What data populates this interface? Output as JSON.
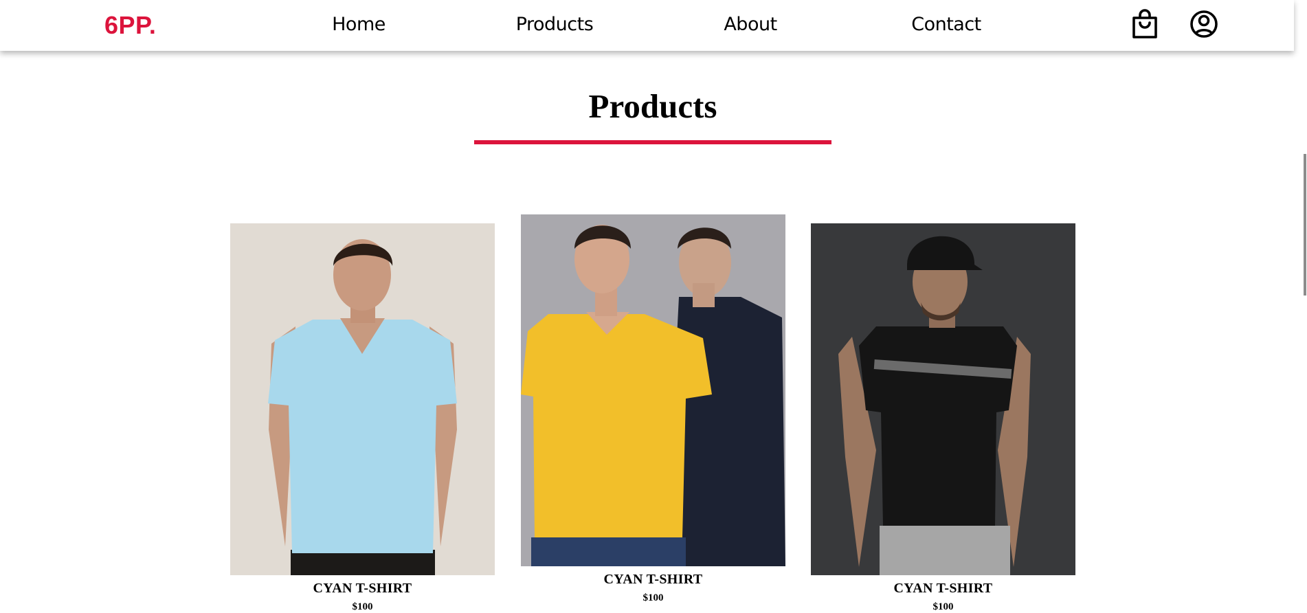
{
  "brand": {
    "logo": "6PP.",
    "accent": "#dc143c"
  },
  "nav": {
    "links": [
      {
        "label": "Home"
      },
      {
        "label": "Products"
      },
      {
        "label": "About"
      },
      {
        "label": "Contact"
      }
    ],
    "icons": [
      "shopping-bag-icon",
      "user-account-icon"
    ]
  },
  "section": {
    "title": "Products"
  },
  "products": [
    {
      "name": "CYAN T-SHIRT",
      "price": "$100",
      "image": "man-in-light-blue-v-neck-tshirt",
      "shirt_color": "#a8d8ec"
    },
    {
      "name": "CYAN T-SHIRT",
      "price": "$100",
      "image": "two-men-yellow-and-navy-tshirts",
      "shirt_color": "#f2bf2a"
    },
    {
      "name": "CYAN T-SHIRT",
      "price": "$100",
      "image": "man-in-black-tshirt-and-cap",
      "shirt_color": "#151515"
    }
  ]
}
